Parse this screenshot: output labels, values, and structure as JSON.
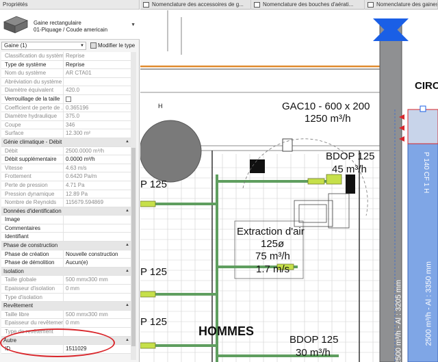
{
  "panel": {
    "title": "Propriétés",
    "type_line1": "Gaine rectangulaire",
    "type_line2": "01-Piquage / Coude americain",
    "instance": "Gaine (1)",
    "edit_type": "Modifier le type"
  },
  "rows": [
    {
      "k": "Classification du système",
      "v": "Reprise",
      "ro": true
    },
    {
      "k": "Type de système",
      "v": "Reprise"
    },
    {
      "k": "Nom du système",
      "v": "AR CTA01",
      "ro": true
    },
    {
      "k": "Abréviation du système",
      "v": "",
      "ro": true
    },
    {
      "k": "Diamètre équivalent",
      "v": "420.0",
      "ro": true
    },
    {
      "k": "Verrouillage de la taille",
      "v": "",
      "cb": true
    },
    {
      "k": "Coefficient de perte de ...",
      "v": "0.365196",
      "ro": true
    },
    {
      "k": "Diamètre hydraulique",
      "v": "375.0",
      "ro": true
    },
    {
      "k": "Coupe",
      "v": "346",
      "ro": true
    },
    {
      "k": "Surface",
      "v": "12.300 m²",
      "ro": true
    },
    {
      "sec": "Génie climatique - Débit"
    },
    {
      "k": "Débit",
      "v": "2500.0000 m³/h",
      "ro": true
    },
    {
      "k": "Débit supplémentaire",
      "v": "0.0000 m³/h"
    },
    {
      "k": "Vitesse",
      "v": "4.63 m/s",
      "ro": true
    },
    {
      "k": "Frottement",
      "v": "0.6420 Pa/m",
      "ro": true
    },
    {
      "k": "Perte de pression",
      "v": "4.71 Pa",
      "ro": true
    },
    {
      "k": "Pression dynamique",
      "v": "12.89 Pa",
      "ro": true
    },
    {
      "k": "Nombre de Reynolds",
      "v": "115679.594869",
      "ro": true
    },
    {
      "sec": "Données d'identification"
    },
    {
      "k": "Image",
      "v": ""
    },
    {
      "k": "Commentaires",
      "v": ""
    },
    {
      "k": "Identifiant",
      "v": ""
    },
    {
      "sec": "Phase de construction"
    },
    {
      "k": "Phase de création",
      "v": "Nouvelle construction"
    },
    {
      "k": "Phase de démolition",
      "v": "Aucun(e)"
    },
    {
      "sec": "Isolation"
    },
    {
      "k": "Taille globale",
      "v": "500 mmx300 mm",
      "ro": true
    },
    {
      "k": "Epaisseur d'isolation",
      "v": "0 mm",
      "ro": true
    },
    {
      "k": "Type d'isolation",
      "v": "",
      "ro": true
    },
    {
      "sec": "Revêtement"
    },
    {
      "k": "Taille libre",
      "v": "500 mmx300 mm",
      "ro": true
    },
    {
      "k": "Epaisseur du revêtement",
      "v": "0 mm",
      "ro": true
    },
    {
      "k": "Type de revêtement",
      "v": "",
      "ro": true
    },
    {
      "sec": "Autre"
    },
    {
      "k": "ID",
      "v": "1511029"
    }
  ],
  "tabs": [
    "Nomenclature des accessoires de g...",
    "Nomenclature des bouches d'aérati...",
    "Nomenclature des gaines"
  ],
  "drawing": {
    "gac": "GAC10 - 600 x 200",
    "gac_flow": "1250 m³/h",
    "bdop1": "BDOP 125",
    "bdop1_flow": "45 m³/h",
    "extr1": "Extraction d'air",
    "extr2": "125ø",
    "extr3": "75 m³/h",
    "extr4": "1.7 m/s",
    "hommes": "HOMMES",
    "bdop2": "BDOP 125",
    "bdop2_flow": "30 m³/h",
    "circ": "CIRC",
    "p125a": "P 125",
    "p125b": "P 125",
    "p125c": "P 125",
    "vert1": "2500 m³/h - Al : 3205 mm",
    "vert2": "2500 m³/h - Al : 3350 mm",
    "vert3": "P 140 CF 1 H",
    "small_h": "H"
  },
  "colors": {
    "duct_grey": "#8f9092",
    "duct_blue": "#7fa6e6",
    "pipe_green": "#5f9e5f",
    "highlight_circle": "#d9262b",
    "accent_orange": "#e08a2e"
  }
}
